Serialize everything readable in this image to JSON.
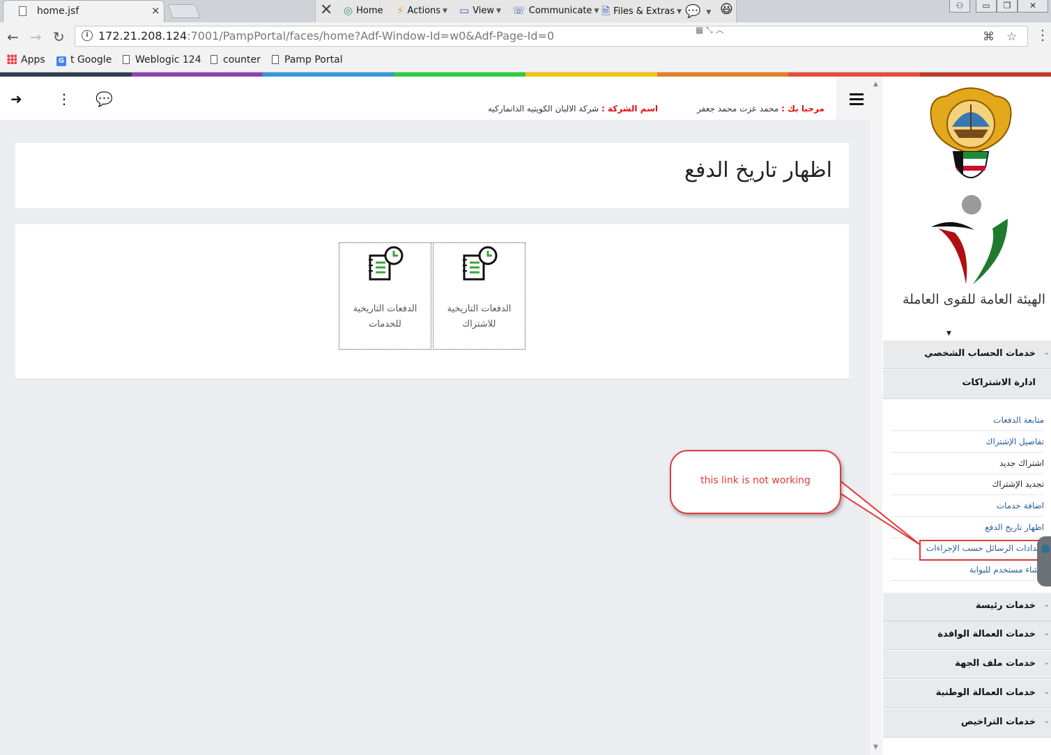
{
  "browser": {
    "tab_title": "home.jsf",
    "tab_close": "×",
    "url_host": "172.21.208.124",
    "url_rest": ":7001/PampPortal/faces/home?Adf-Window-Id=w0&Adf-Page-Id=0",
    "extension_toolbar": {
      "close_glyph": "✕",
      "home": "Home",
      "actions": "Actions",
      "view": "View",
      "communicate": "Communicate",
      "files_extras": "Files & Extras"
    },
    "bookmarks": [
      "Apps",
      "t Google",
      "Weblogic 124",
      "counter",
      "Pamp Portal"
    ]
  },
  "header": {
    "welcome_label": "مرحبا بك :",
    "user_name": "محمد عزت محمد جعفر",
    "company_label": "اسم الشركة :",
    "company_name": "شركة الالبان الكويتيه الدانماركيه"
  },
  "page": {
    "title": "اظهار تاريخ الدفع",
    "tiles": [
      {
        "label": "الدفعات التاريخية\nللاشتراك"
      },
      {
        "label": "الدفعات التاريخية\nللخدمات"
      }
    ]
  },
  "sidebar": {
    "org_name": "الهيئة العامة للقوى العاملة",
    "sections": [
      "خدمات الحساب الشخصي",
      "ادارة الاشتراكات",
      "خدمات رئيسة",
      "خدمات العمالة الوافدة",
      "خدمات ملف الجهة",
      "خدمات العمالة الوطنية",
      "خدمات التراخيص"
    ],
    "subscription_links": [
      "متابعة الدفعات",
      "تفاصيل الإشتراك",
      "اشتراك جديد",
      "تجديد الإشتراك",
      "اضافة خدمات",
      "اظهار تاريخ الدفع",
      "اعدادات الرسائل حسب الإجراءات",
      "انشاء مستخدم للبوابة"
    ]
  },
  "annotation": {
    "callout_text": "this link is not working",
    "color": "#e03a3a"
  },
  "colors": {
    "rainbow": [
      "#2e3e50",
      "#8e44ad",
      "#3498db",
      "#2ecc40",
      "#f1c40f",
      "#e67e22",
      "#e74c3c",
      "#c0392b"
    ]
  }
}
